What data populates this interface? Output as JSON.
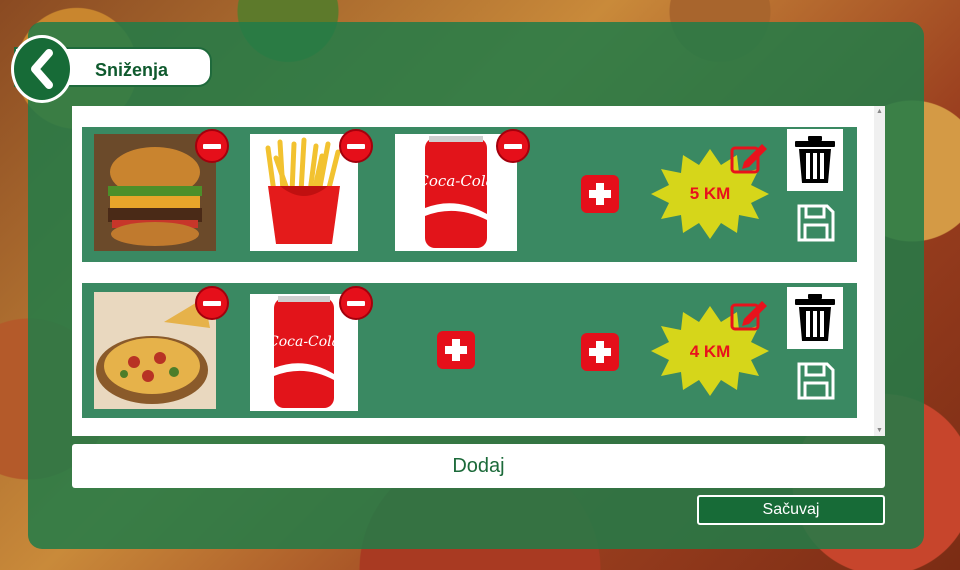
{
  "header": {
    "title": "Sniženja",
    "back_icon": "chevron-left-icon"
  },
  "rows": [
    {
      "items": [
        {
          "name": "burger",
          "icon": "burger-image"
        },
        {
          "name": "fries",
          "icon": "fries-image"
        },
        {
          "name": "cola",
          "icon": "cola-can-image",
          "can_text": "Coca-Cola"
        }
      ],
      "price": "5 KM"
    },
    {
      "items": [
        {
          "name": "pizza",
          "icon": "pizza-image"
        },
        {
          "name": "cola",
          "icon": "cola-can-image",
          "can_text": "Coca-Cola"
        }
      ],
      "price": "4 KM"
    }
  ],
  "actions": {
    "add_label": "Dodaj",
    "save_label": "Sačuvaj"
  },
  "colors": {
    "panel": "#227c48",
    "row": "#3a8962",
    "accent_red": "#e50f1a",
    "burst": "#d6d61a",
    "header_green": "#0f5a2e"
  }
}
